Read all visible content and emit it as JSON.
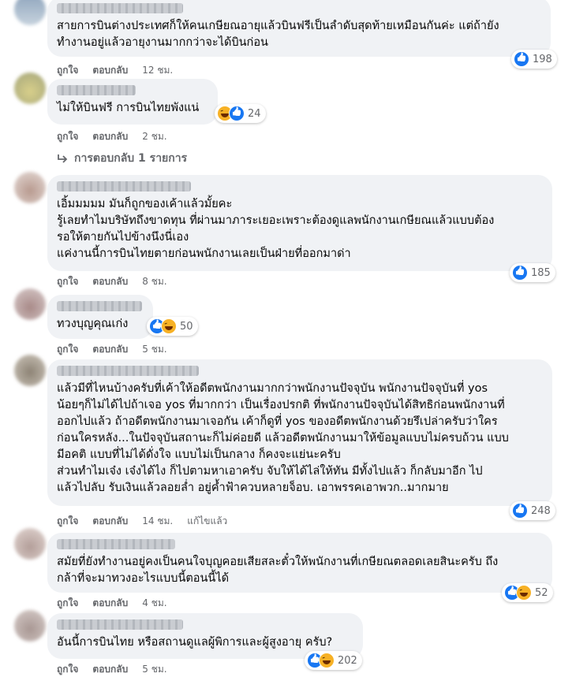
{
  "labels": {
    "like": "ถูกใจ",
    "reply": "ตอบกลับ",
    "edited": "แก้ไขแล้ว"
  },
  "comments": [
    {
      "text": "สายการบินต่างประเทศก็ให้คนเกษียณอายุแล้วบินฟรีเป็นลำดับสุดท้ายเหมือนกันค่ะ แต่ถ้ายัง\nทำงานอยู่แล้วอายุงานมากกว่าจะได้บินก่อน",
      "time": "12 ชม.",
      "reactions": "198"
    },
    {
      "text": "ไม่ให้บินฟรี การบินไทยพังแน่",
      "time": "2 ชม.",
      "reactions": "24"
    },
    {
      "text": "เอิ้มมมมม มันก็ถูกของเค้าแล้วมั้ยคะ\nรู้เลยทำไมบริษัทถึงขาดทุน ที่ผ่านมาภาระเยอะเพราะต้องดูแลพนักงานเกษียณแล้วแบบต้อง\nรอให้ตายกันไปข้างนึงนี่เอง\nแค่งานนี้การบินไทยตายก่อนพนักงานเลยเป็นฝ่ายที่ออกมาด่า",
      "time": "8 ชม.",
      "reactions": "185"
    },
    {
      "text": "ทวงบุญคุณเก่ง",
      "time": "5 ชม.",
      "reactions": "50"
    },
    {
      "text": "แล้วมีที่ไหนบ้างครับที่เค้าให้อดีตพนักงานมากกว่าพนักงานปัจจุบัน พนักงานปัจจุบันที่ yos\nน้อยๆก็ไม่ได้ไปถ้าเจอ yos ที่มากกว่า เป็นเรื่องปรกติ ที่พนักงานปัจจุบันได้สิทธิก่อนพนักงานที่\nออกไปแล้ว ถ้าอดีตพนักงานมาเจอกัน เค้าก็ดูที่ yos ของอดีตพนักงานด้วยรึเปล่าครับว่าใคร\nก่อนใครหลัง...ในปัจจุบันสถานะก็ไม่ค่อยดี แล้วอดีตพนักงานมาให้ข้อมูลแบบไม่ครบถ้วน แบบ\nมีอคติ แบบที่ไม่ได้ดั่งใจ แบบไม่เป็นกลาง ก็คงจะแย่นะครับ\nส่วนทำไมเจ๋ง เจ๋งได้ไง ก็ไปตามหาเอาครับ จับให้ได้ไล่ให้ทัน มีทั้งไปแล้ว ก็กลับมาอีก ไป\nแล้วไปลับ รับเงินแล้วลอยล่ำ อยู่ค้ำฟ้าควบหลายจ็อบ. เอาพรรคเอาพวก..มากมาย",
      "time": "14 ชม.",
      "reactions": "248"
    },
    {
      "text": "สมัยที่ยังทำงานอยู่คงเป็นคนใจบุญคอยเสียสละตั๋วให้พนักงานที่เกษียณตลอดเลยสินะครับ ถึง\nกล้าที่จะมาทวงอะไรแบบนี้ตอนนี้ได้",
      "time": "4 ชม.",
      "reactions": "52"
    },
    {
      "text": "อันนี้การบินไทย หรือสถานดูแลผู้พิการและผู้สูงอายุ ครับ?",
      "time": "5 ชม.",
      "reactions": "202"
    }
  ],
  "replies_link": "การตอบกลับ 1 รายการ",
  "colors": {
    "bubble": "#f0f2f5",
    "meta": "#65676b",
    "like": "#1877f2",
    "haha": "#f7b125"
  }
}
